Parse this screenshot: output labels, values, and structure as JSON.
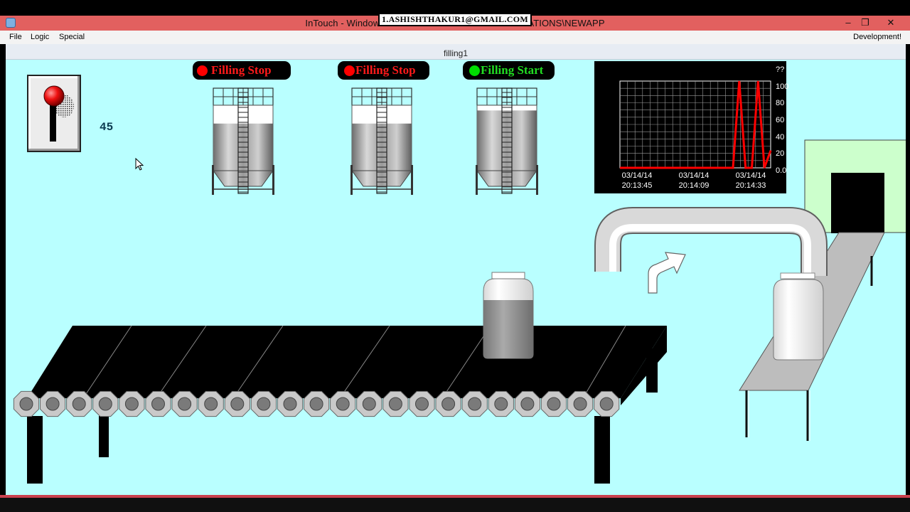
{
  "window": {
    "title": "InTouch - WindowViewer - C:\\...\\...\\INTOUCH APPLICATIONS\\NEWAPP",
    "watermark": "1.ASHISHTHAKUR1@GMAIL.COM",
    "controls": {
      "minimize": "–",
      "restore": "❐",
      "close": "✕"
    }
  },
  "menubar": {
    "items": [
      "File",
      "Logic",
      "Special"
    ],
    "right_label": "Development!"
  },
  "canvas": {
    "title": "filling1"
  },
  "switch": {
    "icon": "toggle-switch-icon",
    "state": "on"
  },
  "counter": {
    "value": "45"
  },
  "tanks": [
    {
      "button_label": "Filling Stop",
      "status": "stopped",
      "fill_fraction": 0.72
    },
    {
      "button_label": "Filling Stop",
      "status": "stopped",
      "fill_fraction": 0.72
    },
    {
      "button_label": "Filling Start",
      "status": "filling",
      "fill_fraction": 0.92
    }
  ],
  "colors": {
    "stop": "#ff0000",
    "start": "#00ee00",
    "canvas_bg": "#b9ffff",
    "trend_line": "#ff0000"
  },
  "chart_data": {
    "type": "line",
    "x_ticks": [
      "03/14/14\n20:13:45",
      "03/14/14\n20:14:09",
      "03/14/14\n20:14:33"
    ],
    "y_ticks": [
      "??",
      "100",
      "80",
      "60",
      "40",
      "20",
      "0.0"
    ],
    "ylim": [
      0,
      100
    ],
    "series": [
      {
        "values": [
          0,
          0,
          0,
          0,
          0,
          0,
          0,
          0,
          0,
          0,
          0,
          0,
          0,
          0,
          0,
          0,
          0,
          0,
          0,
          100,
          0,
          0,
          100,
          0,
          20
        ]
      }
    ],
    "grid": true
  },
  "cursor": {
    "icon": "mouse-pointer-icon"
  }
}
